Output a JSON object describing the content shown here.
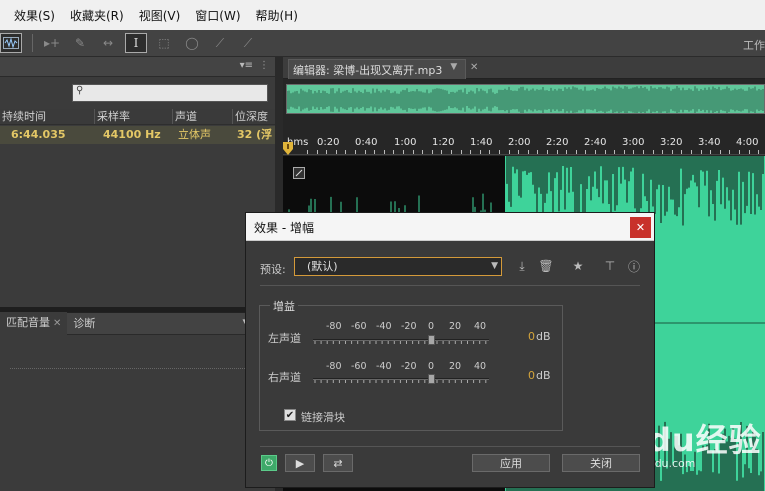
{
  "menubar": {
    "items": [
      "效果(S)",
      "收藏夹(R)",
      "视图(V)",
      "窗口(W)",
      "帮助(H)"
    ]
  },
  "toolbar": {
    "workspace_label": "工作"
  },
  "files_panel": {
    "columns": [
      "持续时间",
      "采样率",
      "声道",
      "位深度"
    ],
    "row": {
      "duration": "6:44.035",
      "sample_rate": "44100 Hz",
      "channels": "立体声",
      "bit_depth": "32 (浮"
    }
  },
  "lower_panel": {
    "tabs": [
      "匹配音量",
      "诊断"
    ]
  },
  "editor": {
    "tab_label": "编辑器: 梁博-出现又离开.mp3",
    "ruler_labels": [
      "hms",
      "0:20",
      "0:40",
      "1:00",
      "1:20",
      "1:40",
      "2:00",
      "2:20",
      "2:40",
      "3:00",
      "3:20",
      "3:40",
      "4:00"
    ]
  },
  "dialog": {
    "title": "效果 - 增幅",
    "preset_label": "预设:",
    "preset_value": "(默认)",
    "gain_group_title": "增益",
    "scale_labels": [
      "-80",
      "-60",
      "-40",
      "-20",
      "0",
      "20",
      "40"
    ],
    "channels": [
      {
        "label": "左声道",
        "value": "0",
        "unit": "dB"
      },
      {
        "label": "右声道",
        "value": "0",
        "unit": "dB"
      }
    ],
    "link_sliders_label": "链接滑块",
    "link_sliders_checked": true,
    "apply_label": "应用",
    "close_label": "关闭"
  },
  "watermark": {
    "logo": "Baidu经验",
    "url": "jingyan.baidu.com"
  },
  "colors": {
    "waveform": "#3ed39a",
    "accent_yellow": "#d4a43a",
    "close_red": "#c8312b"
  }
}
